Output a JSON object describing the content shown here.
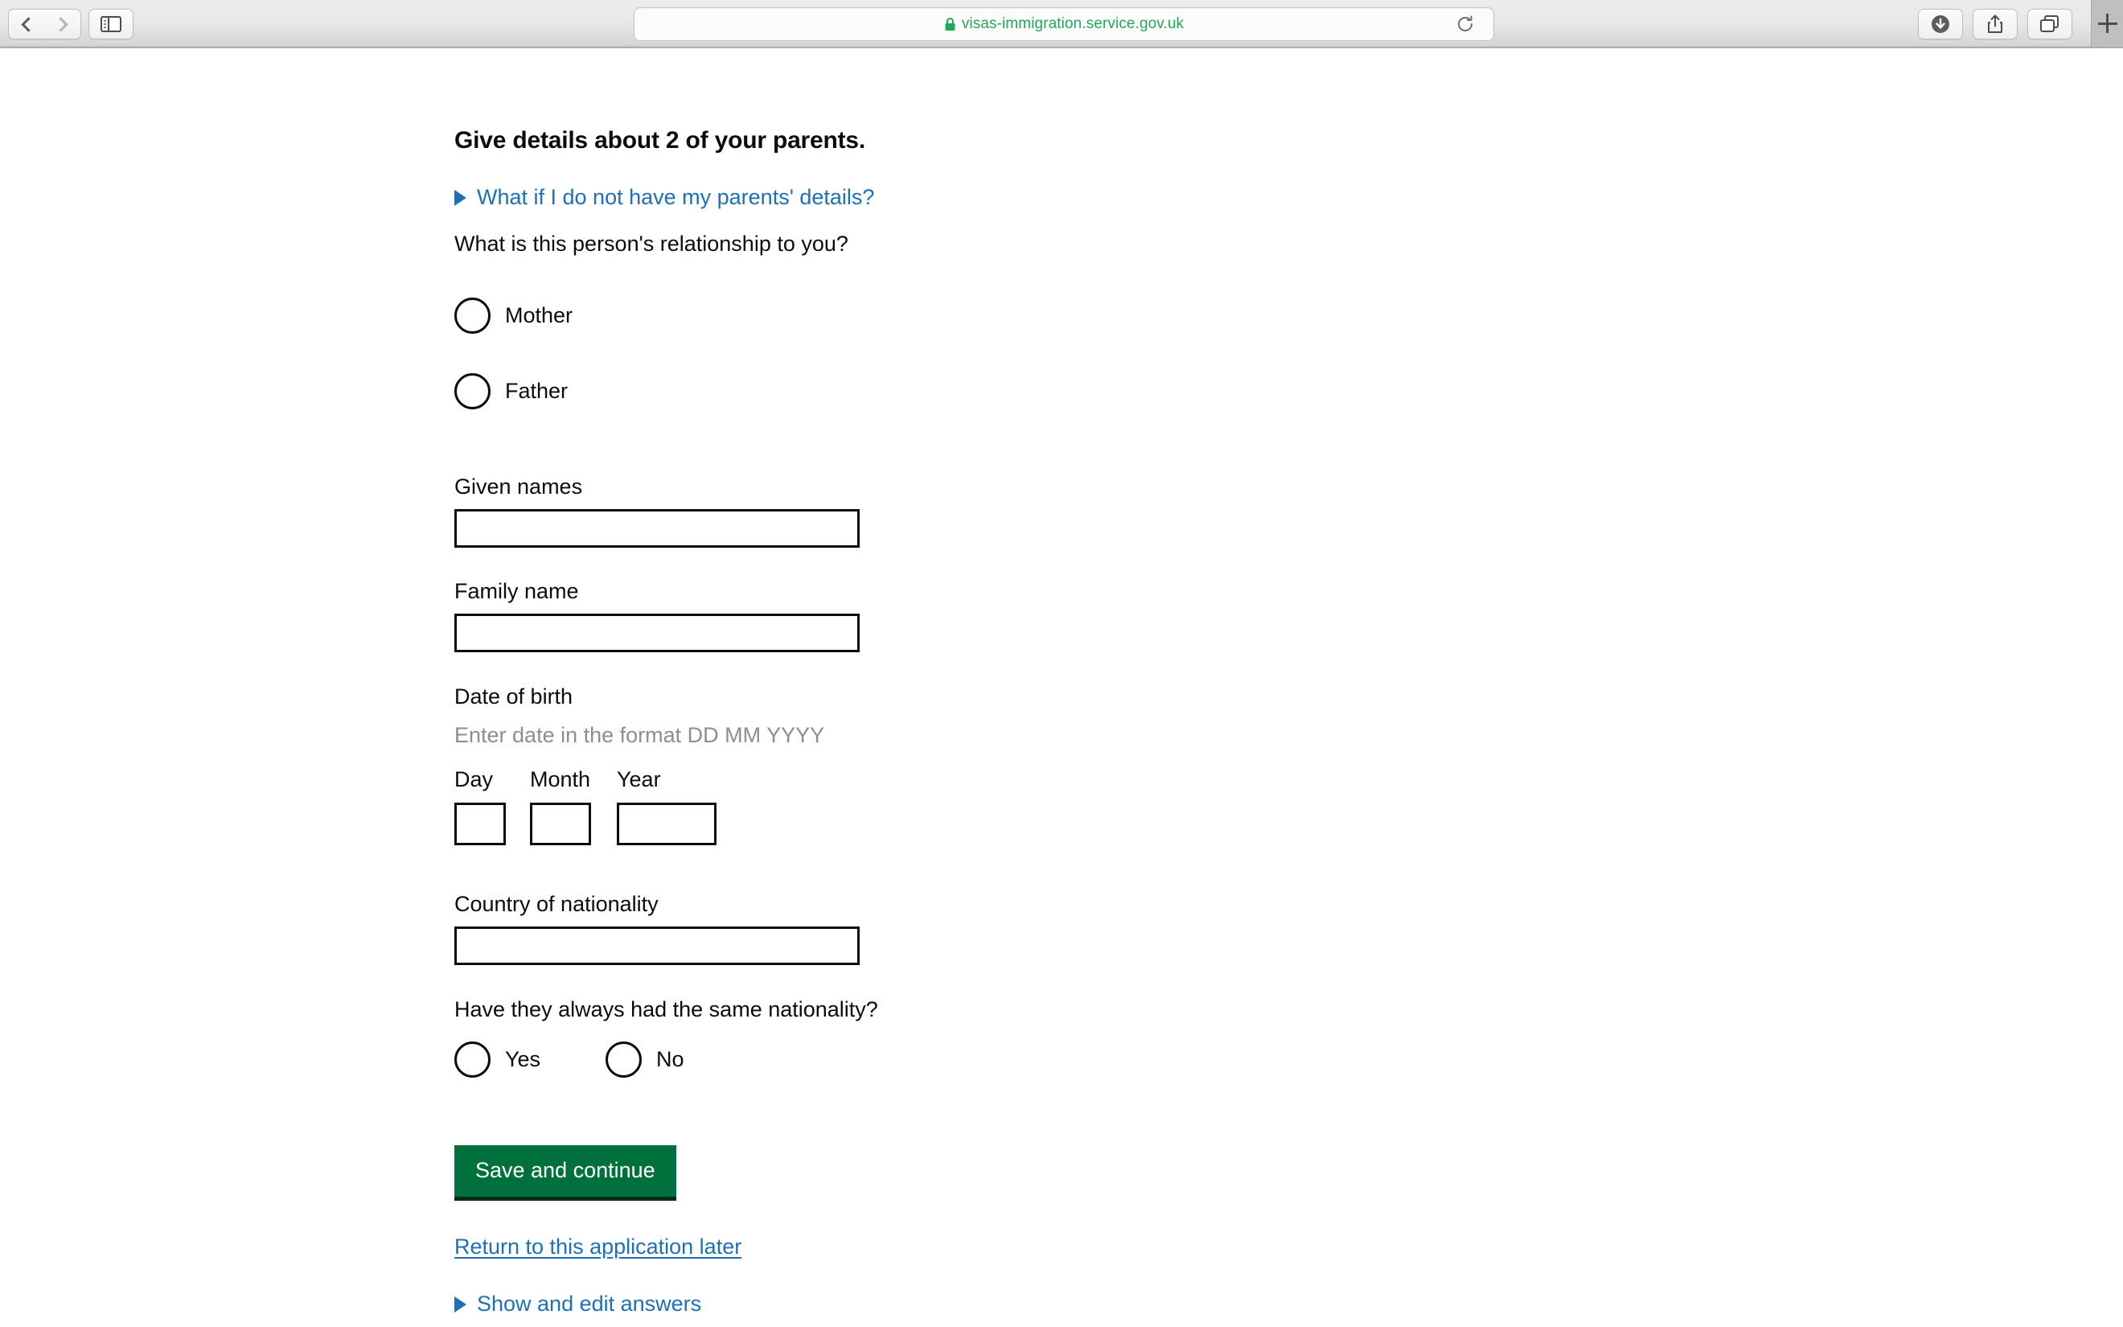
{
  "browser": {
    "url": "visas-immigration.service.gov.uk",
    "lock_icon": "lock-icon",
    "back_icon": "chevron-left-icon",
    "forward_icon": "chevron-right-icon",
    "sidebar_icon": "sidebar-toggle-icon",
    "reload_icon": "reload-icon",
    "download_icon": "download-icon",
    "share_icon": "share-icon",
    "tabs_icon": "tab-overview-icon",
    "new_tab_label": "+"
  },
  "page": {
    "title": "Give details about 2 of your parents.",
    "details_parents": {
      "icon": "disclosure-triangle-icon",
      "label": "What if I do not have my parents' details?"
    },
    "relationship": {
      "question": "What is this person's relationship to you?",
      "options": [
        {
          "label": "Mother",
          "selected": false
        },
        {
          "label": "Father",
          "selected": false
        }
      ]
    },
    "given_names": {
      "label": "Given names",
      "value": ""
    },
    "family_name": {
      "label": "Family name",
      "value": ""
    },
    "date_of_birth": {
      "label": "Date of birth",
      "hint": "Enter date in the format DD MM YYYY",
      "day": {
        "label": "Day",
        "value": ""
      },
      "month": {
        "label": "Month",
        "value": ""
      },
      "year": {
        "label": "Year",
        "value": ""
      }
    },
    "country_of_nationality": {
      "label": "Country of nationality",
      "value": ""
    },
    "same_nationality": {
      "question": "Have they always had the same nationality?",
      "options": [
        {
          "label": "Yes",
          "selected": false
        },
        {
          "label": "No",
          "selected": false
        }
      ]
    },
    "save_button": "Save and continue",
    "return_link": "Return to this application later",
    "details_answers": {
      "icon": "disclosure-triangle-icon",
      "label": "Show and edit answers"
    }
  },
  "colors": {
    "govuk_green": "#00703c",
    "govuk_blue": "#1d70b8",
    "text_black": "#0b0c0c",
    "hint_grey": "#8a8f93",
    "secure_green": "#22a75a"
  }
}
